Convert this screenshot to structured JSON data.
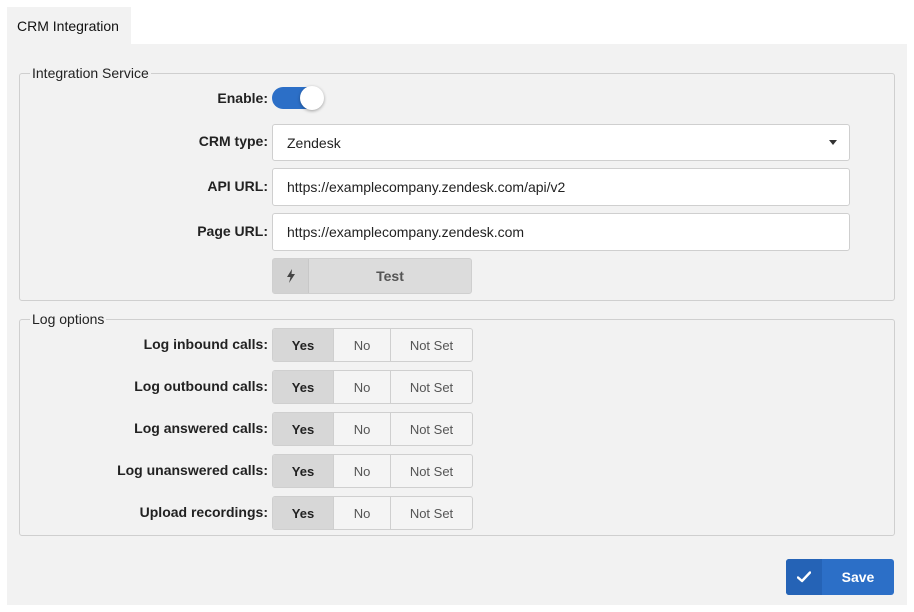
{
  "tab": {
    "label": "CRM Integration"
  },
  "integration": {
    "legend": "Integration Service",
    "enable_label": "Enable:",
    "enabled": true,
    "crm_type_label": "CRM type:",
    "crm_type_value": "Zendesk",
    "api_url_label": "API URL:",
    "api_url_value": "https://examplecompany.zendesk.com/api/v2",
    "page_url_label": "Page URL:",
    "page_url_value": "https://examplecompany.zendesk.com",
    "test_label": "Test"
  },
  "log_options": {
    "legend": "Log options",
    "option_labels": {
      "yes": "Yes",
      "no": "No",
      "not_set": "Not Set"
    },
    "rows": [
      {
        "label": "Log inbound calls:",
        "selected": "Yes"
      },
      {
        "label": "Log outbound calls:",
        "selected": "Yes"
      },
      {
        "label": "Log answered calls:",
        "selected": "Yes"
      },
      {
        "label": "Log unanswered calls:",
        "selected": "Yes"
      },
      {
        "label": "Upload recordings:",
        "selected": "Yes"
      }
    ]
  },
  "footer": {
    "save_label": "Save"
  },
  "icons": {
    "test": "bolt-icon",
    "save": "check-icon"
  },
  "colors": {
    "accent": "#2c6fc7",
    "panel": "#f2f2f2",
    "selected_segment": "#d7d7d7"
  }
}
